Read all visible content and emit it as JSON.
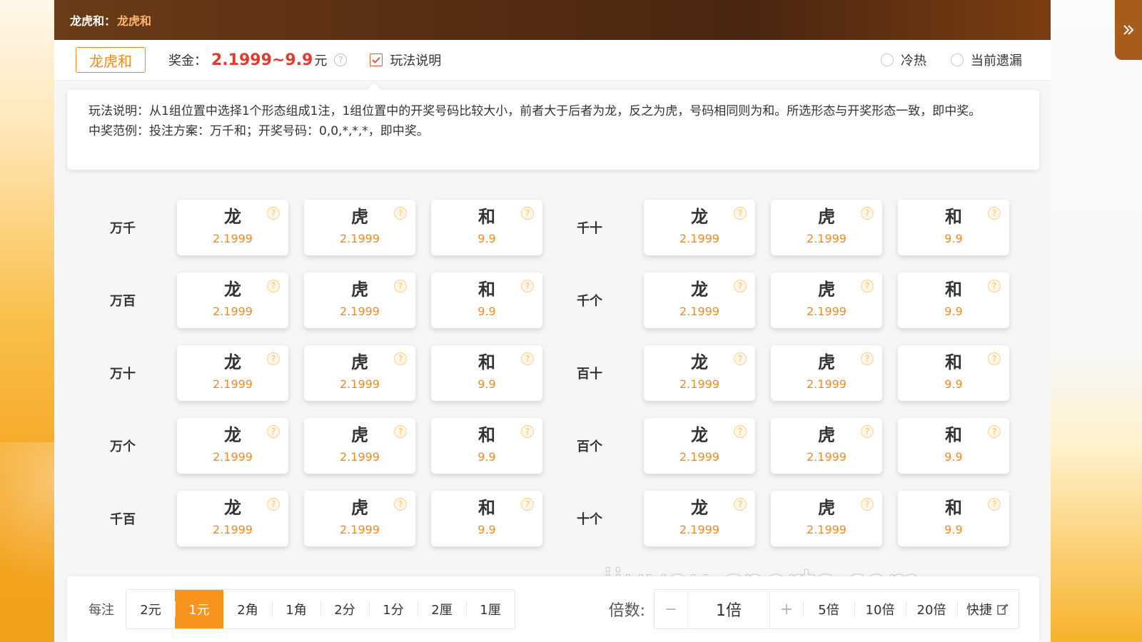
{
  "topbar": {
    "label": "龙虎和：",
    "value": "龙虎和"
  },
  "subbar": {
    "chip": "龙虎和",
    "prize_label": "奖金：",
    "prize_range": "2.1999~9.9",
    "prize_unit": "元",
    "help": "?",
    "rule_toggle_label": "玩法说明",
    "radio_hot_cold": "冷热",
    "radio_missing": "当前遗漏"
  },
  "rules": {
    "line1": "玩法说明：从1组位置中选择1个形态组成1注，1组位置中的开奖号码比较大小，前者大于后者为龙，反之为虎，号码相同则为和。所选形态与开奖形态一致，即中奖。",
    "line2": "中奖范例：投注方案：万千和；开奖号码：0,0,*,*,*，即中奖。"
  },
  "bet_groups": {
    "left": [
      {
        "label": "万千",
        "options": [
          {
            "name": "龙",
            "odds": "2.1999"
          },
          {
            "name": "虎",
            "odds": "2.1999"
          },
          {
            "name": "和",
            "odds": "9.9"
          }
        ]
      },
      {
        "label": "万百",
        "options": [
          {
            "name": "龙",
            "odds": "2.1999"
          },
          {
            "name": "虎",
            "odds": "2.1999"
          },
          {
            "name": "和",
            "odds": "9.9"
          }
        ]
      },
      {
        "label": "万十",
        "options": [
          {
            "name": "龙",
            "odds": "2.1999"
          },
          {
            "name": "虎",
            "odds": "2.1999"
          },
          {
            "name": "和",
            "odds": "9.9"
          }
        ]
      },
      {
        "label": "万个",
        "options": [
          {
            "name": "龙",
            "odds": "2.1999"
          },
          {
            "name": "虎",
            "odds": "2.1999"
          },
          {
            "name": "和",
            "odds": "9.9"
          }
        ]
      },
      {
        "label": "千百",
        "options": [
          {
            "name": "龙",
            "odds": "2.1999"
          },
          {
            "name": "虎",
            "odds": "2.1999"
          },
          {
            "name": "和",
            "odds": "9.9"
          }
        ]
      }
    ],
    "right": [
      {
        "label": "千十",
        "options": [
          {
            "name": "龙",
            "odds": "2.1999"
          },
          {
            "name": "虎",
            "odds": "2.1999"
          },
          {
            "name": "和",
            "odds": "9.9"
          }
        ]
      },
      {
        "label": "千个",
        "options": [
          {
            "name": "龙",
            "odds": "2.1999"
          },
          {
            "name": "虎",
            "odds": "2.1999"
          },
          {
            "name": "和",
            "odds": "9.9"
          }
        ]
      },
      {
        "label": "百十",
        "options": [
          {
            "name": "龙",
            "odds": "2.1999"
          },
          {
            "name": "虎",
            "odds": "2.1999"
          },
          {
            "name": "和",
            "odds": "9.9"
          }
        ]
      },
      {
        "label": "百个",
        "options": [
          {
            "name": "龙",
            "odds": "2.1999"
          },
          {
            "name": "虎",
            "odds": "2.1999"
          },
          {
            "name": "和",
            "odds": "9.9"
          }
        ]
      },
      {
        "label": "十个",
        "options": [
          {
            "name": "龙",
            "odds": "2.1999"
          },
          {
            "name": "虎",
            "odds": "2.1999"
          },
          {
            "name": "和",
            "odds": "9.9"
          }
        ]
      }
    ]
  },
  "watermark": "jiuyou-sports.com",
  "bottom": {
    "per_bet_label": "每注",
    "denominations": [
      "2元",
      "1元",
      "2角",
      "1角",
      "2分",
      "1分",
      "2厘",
      "1厘"
    ],
    "selected_denomination_index": 1,
    "multiplier_label": "倍数:",
    "multiplier_value": "1倍",
    "quick_multipliers": [
      "5倍",
      "10倍",
      "20倍"
    ],
    "quick_edit_label": "快捷"
  },
  "icons": {
    "side_toggle": "double-chevron-right-icon",
    "check": "checkmark-icon",
    "edit": "edit-icon",
    "minus": "minus-icon",
    "plus": "plus-icon"
  }
}
